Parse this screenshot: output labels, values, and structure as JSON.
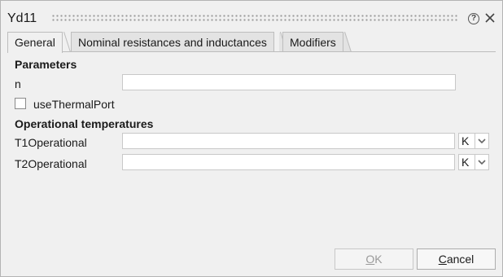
{
  "window": {
    "title": "Yd11"
  },
  "tabs": [
    {
      "label": "General",
      "active": true
    },
    {
      "label": "Nominal resistances and inductances",
      "active": false
    },
    {
      "label": "Modifiers",
      "active": false
    }
  ],
  "parameters": {
    "section_title": "Parameters",
    "n_label": "n",
    "n_value": "",
    "use_thermal_port_label": "useThermalPort",
    "use_thermal_port_checked": false
  },
  "operational": {
    "section_title": "Operational temperatures",
    "t1_label": "T1Operational",
    "t1_value": "",
    "t1_unit": "K",
    "t2_label": "T2Operational",
    "t2_value": "",
    "t2_unit": "K"
  },
  "buttons": {
    "ok_label_accel": "O",
    "ok_label_rest": "K",
    "ok_enabled": false,
    "cancel_label_accel": "C",
    "cancel_label_rest": "ancel"
  },
  "icons": {
    "help": "help-icon",
    "close": "close-icon",
    "unit_dropdown": "chevron-down-icon"
  },
  "colors": {
    "dialog_bg": "#f0f0f0",
    "input_border": "#c8c8c8",
    "disabled_text": "#9a9a9a"
  }
}
